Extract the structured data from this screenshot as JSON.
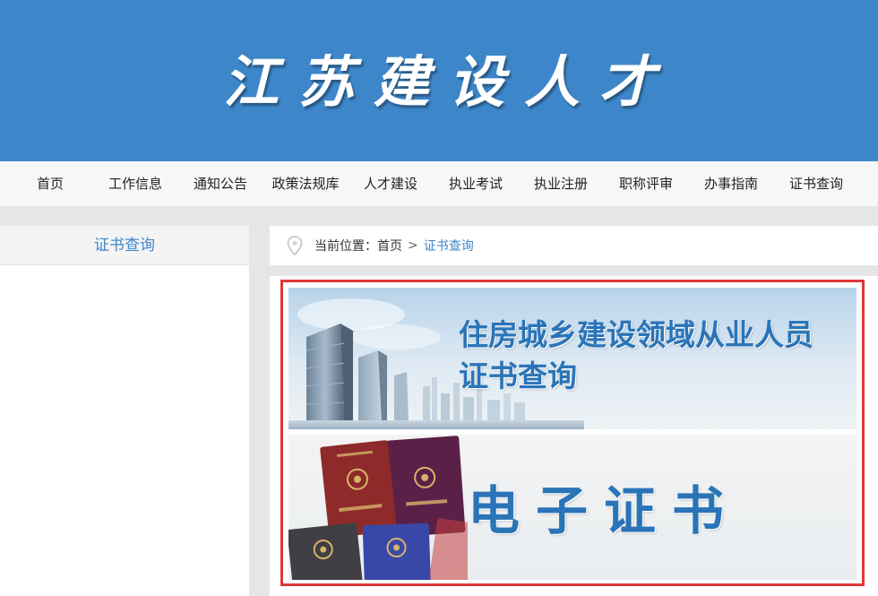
{
  "header": {
    "title": "江苏建设人才"
  },
  "nav": {
    "items": [
      {
        "label": "首页"
      },
      {
        "label": "工作信息"
      },
      {
        "label": "通知公告"
      },
      {
        "label": "政策法规库"
      },
      {
        "label": "人才建设"
      },
      {
        "label": "执业考试"
      },
      {
        "label": "执业注册"
      },
      {
        "label": "职称评审"
      },
      {
        "label": "办事指南"
      },
      {
        "label": "证书查询"
      }
    ]
  },
  "sidebar": {
    "title": "证书查询"
  },
  "breadcrumb": {
    "prefix": "当前位置：",
    "home": "首页",
    "separator": ">",
    "current": "证书查询"
  },
  "banners": {
    "query": {
      "line1": "住房城乡建设领域从业人员",
      "line2": "证书查询"
    },
    "ecert": {
      "title": "电子证书"
    }
  },
  "colors": {
    "primary": "#3d86c9",
    "frame": "#e03838",
    "cert_red": "#8e2a2a",
    "cert_purple": "#5a2048",
    "cert_blue": "#3848a8",
    "cert_gray": "#3f3f44"
  }
}
